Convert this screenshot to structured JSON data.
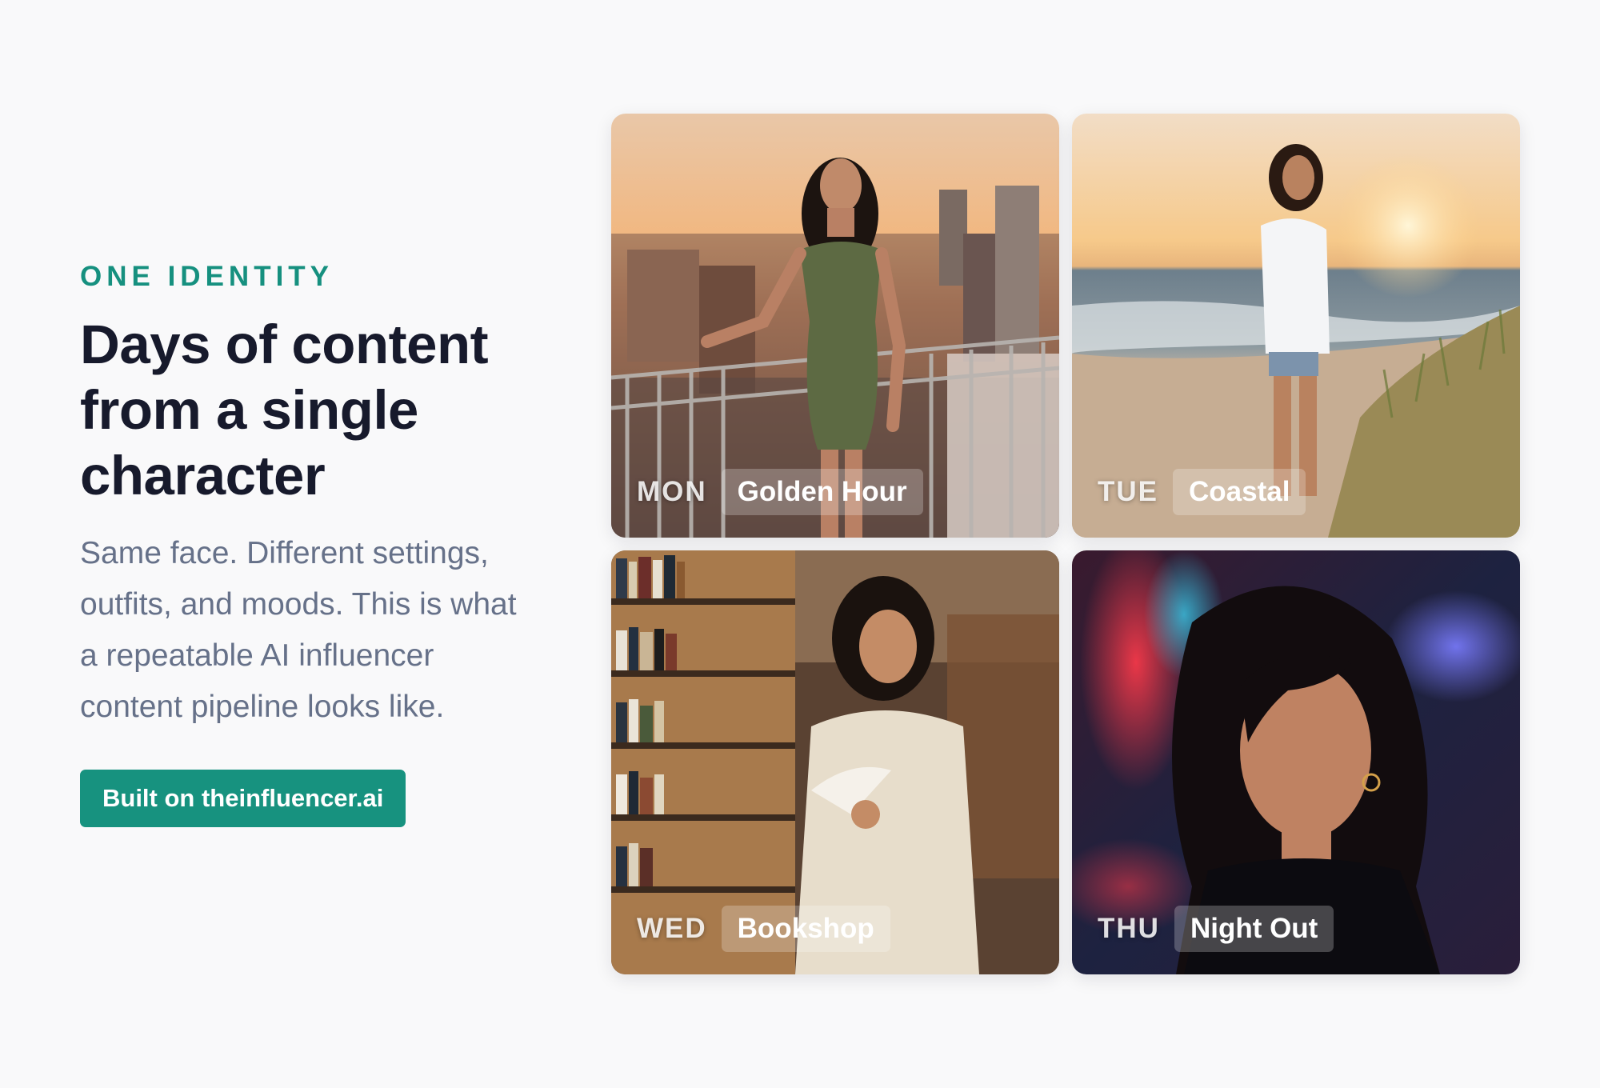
{
  "intro": {
    "eyebrow": "ONE IDENTITY",
    "headline_lines": [
      "Days of content",
      "from a single",
      "character"
    ],
    "body_lines": [
      "Same face. Different settings,",
      "outfits, and moods. This is what",
      "a repeatable AI influencer",
      "content pipeline looks like."
    ],
    "cta_label": "Built on theinfluencer.ai"
  },
  "cards": [
    {
      "day": "MON",
      "title": "Golden Hour",
      "scene": "rooftop-sunset-city"
    },
    {
      "day": "TUE",
      "title": "Coastal",
      "scene": "beach-sunset-dunes"
    },
    {
      "day": "WED",
      "title": "Bookshop",
      "scene": "bookstore-reading"
    },
    {
      "day": "THU",
      "title": "Night Out",
      "scene": "neon-city-night-portrait"
    }
  ],
  "colors": {
    "accent": "#17927f",
    "eyebrow": "#16907f",
    "headline": "#171a2c",
    "body": "#667189",
    "background": "#f9f9fa"
  }
}
